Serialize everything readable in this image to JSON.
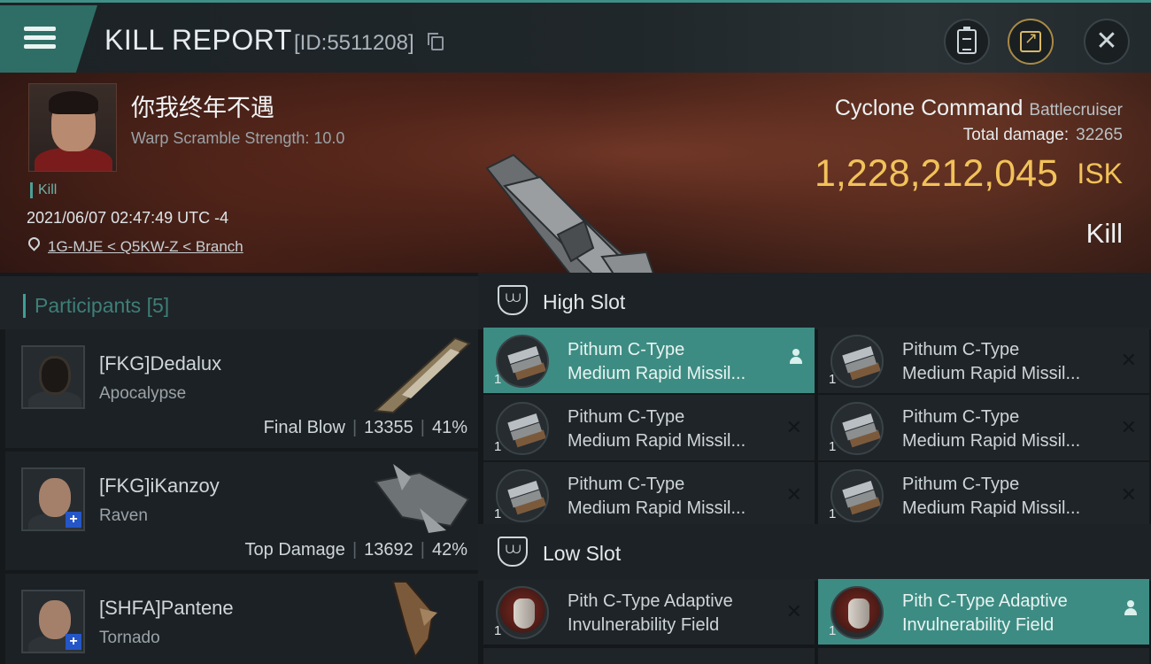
{
  "header": {
    "title": "KILL REPORT",
    "report_id": "[ID:5511208]",
    "buttons": [
      "clipboard-icon",
      "share-icon",
      "close-icon"
    ],
    "close_glyph": "✕"
  },
  "kill": {
    "pilot_name": "你我终年不遇",
    "scramble_strength": "Warp Scramble Strength: 10.0",
    "tag": "Kill",
    "datetime": "2021/06/07 02:47:49 UTC -4",
    "location": "1G-MJE < Q5KW-Z < Branch",
    "ship_name": "Cyclone Command",
    "ship_class": "Battlecruiser",
    "total_damage_label": "Total damage:",
    "total_damage": "32265",
    "isk_value": "1,228,212,045",
    "isk_unit": "ISK",
    "result": "Kill"
  },
  "participants": {
    "label": "Participants",
    "count": "[5]",
    "rows": [
      {
        "name": "[FKG]Dedalux",
        "ship": "Apocalypse",
        "role": "Final Blow",
        "damage": "13355",
        "percent": "41%"
      },
      {
        "name": "[FKG]iKanzoy",
        "ship": "Raven",
        "role": "Top Damage",
        "damage": "13692",
        "percent": "42%"
      },
      {
        "name": "[SHFA]Pantene",
        "ship": "Tornado",
        "role": "",
        "damage": "",
        "percent": ""
      }
    ]
  },
  "slots": {
    "high_label": "High Slot",
    "low_label": "Low Slot",
    "high_modules": [
      {
        "line1": "Pithum C-Type",
        "line2": "Medium Rapid Missil...",
        "qty": "1",
        "status": "person-icon"
      },
      {
        "line1": "Pithum C-Type",
        "line2": "Medium Rapid Missil...",
        "qty": "1",
        "status": "✕"
      },
      {
        "line1": "Pithum C-Type",
        "line2": "Medium Rapid Missil...",
        "qty": "1",
        "status": "✕"
      },
      {
        "line1": "Pithum C-Type",
        "line2": "Medium Rapid Missil...",
        "qty": "1",
        "status": "✕"
      },
      {
        "line1": "Pithum C-Type",
        "line2": "Medium Rapid Missil...",
        "qty": "1",
        "status": "✕"
      },
      {
        "line1": "Pithum C-Type",
        "line2": "Medium Rapid Missil...",
        "qty": "1",
        "status": "✕"
      }
    ],
    "low_modules": [
      {
        "line1": "Pith C-Type Adaptive",
        "line2": "Invulnerability Field",
        "qty": "1",
        "status": "✕"
      },
      {
        "line1": "Pith C-Type Adaptive",
        "line2": "Invulnerability Field",
        "qty": "1",
        "status": "person-icon"
      }
    ]
  }
}
